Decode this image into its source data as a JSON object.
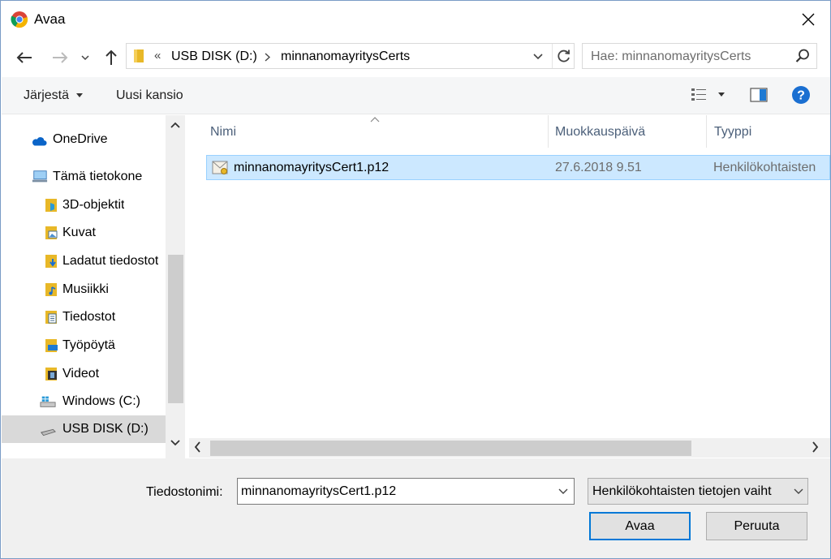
{
  "window": {
    "title": "Avaa"
  },
  "nav": {
    "breadcrumb_prefix": "«",
    "crumbs": [
      "USB DISK (D:)",
      "minnanomayritysCerts"
    ],
    "search_placeholder": "Hae: minnanomayritysCerts"
  },
  "toolbar": {
    "organize_label": "Järjestä",
    "new_folder_label": "Uusi kansio"
  },
  "sidebar": {
    "items": [
      {
        "label": "OneDrive",
        "icon": "cloud-icon"
      },
      {
        "label": "Tämä tietokone",
        "icon": "computer-icon"
      },
      {
        "label": "3D-objektit",
        "icon": "3d-objects-folder-icon"
      },
      {
        "label": "Kuvat",
        "icon": "pictures-folder-icon"
      },
      {
        "label": "Ladatut tiedostot",
        "icon": "downloads-folder-icon"
      },
      {
        "label": "Musiikki",
        "icon": "music-folder-icon"
      },
      {
        "label": "Tiedostot",
        "icon": "documents-folder-icon"
      },
      {
        "label": "Työpöytä",
        "icon": "desktop-folder-icon"
      },
      {
        "label": "Videot",
        "icon": "videos-folder-icon"
      },
      {
        "label": "Windows (C:)",
        "icon": "windows-drive-icon"
      },
      {
        "label": "USB DISK (D:)",
        "icon": "usb-drive-icon",
        "selected": true
      }
    ]
  },
  "files": {
    "columns": [
      "Nimi",
      "Muokkauspäivä",
      "Tyyppi"
    ],
    "rows": [
      {
        "name": "minnanomayritysCert1.p12",
        "modified": "27.6.2018 9.51",
        "type": "Henkilökohtaisten"
      }
    ]
  },
  "footer": {
    "filename_label": "Tiedostonimi:",
    "filename_value": "minnanomayritysCert1.p12",
    "filetype_value": "Henkilökohtaisten tietojen vaiht",
    "open_label": "Avaa",
    "cancel_label": "Peruuta"
  },
  "colors": {
    "selection": "#cce8ff",
    "selection_border": "#99d1ff",
    "accent": "#0078d7"
  }
}
